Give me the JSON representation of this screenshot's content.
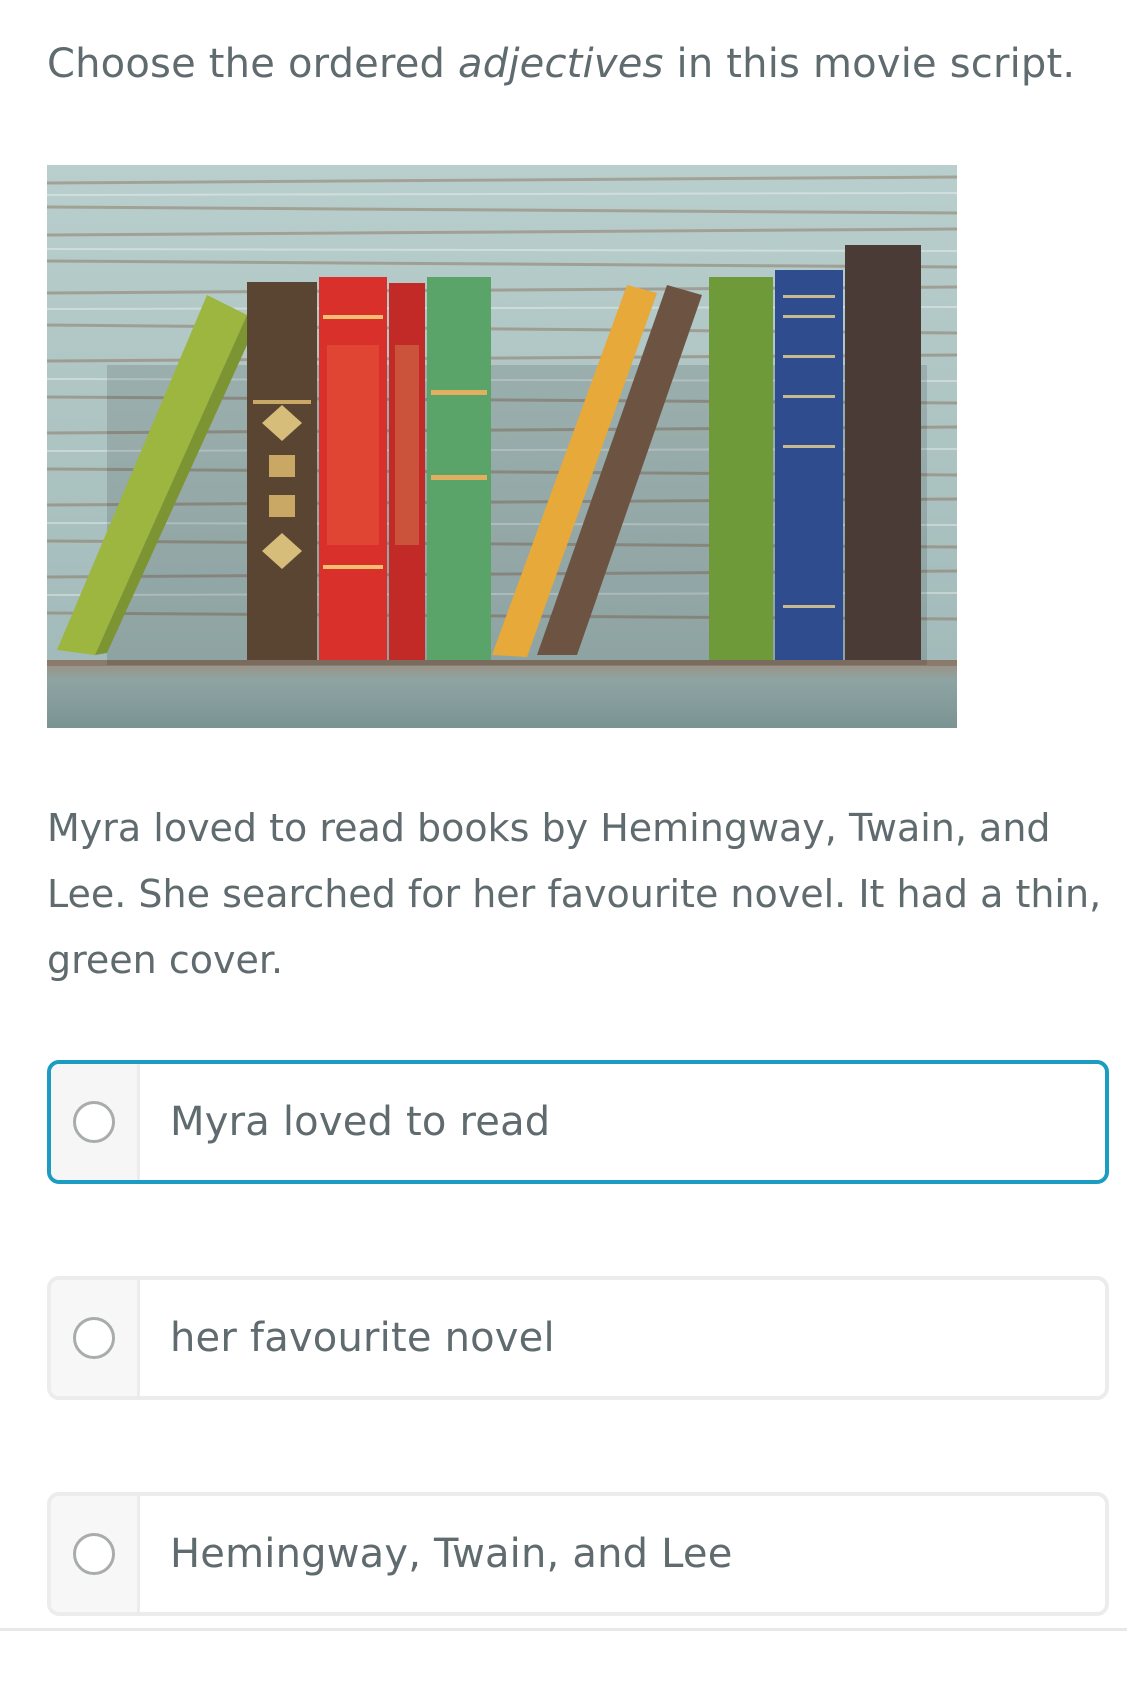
{
  "question": {
    "before": "Choose the ordered ",
    "emphasis": "adjectives",
    "after": " in this movie script."
  },
  "image": {
    "icon": "books-on-shelf-photo",
    "colors": {
      "wall": "#a9c2c1",
      "shelf": "#8fa6a5",
      "books": [
        "#9cb640",
        "#5a4432",
        "#d9302c",
        "#c9302a",
        "#5aa46a",
        "#e6a93a",
        "#6d5442",
        "#6e9a3a",
        "#2f4c8e",
        "#4a3b36"
      ]
    }
  },
  "passage": {
    "text": "Myra loved to read books by Hemingway, Twain, and Lee. She searched for her favourite novel. It had a thin, green cover."
  },
  "options": [
    {
      "label": "Myra loved to read",
      "selected": true
    },
    {
      "label": "her favourite novel",
      "selected": false
    },
    {
      "label": "Hemingway, Twain, and Lee",
      "selected": false
    }
  ],
  "colors": {
    "accent": "#1c9cc3",
    "text": "#5f6b6e",
    "border": "#ececec"
  }
}
